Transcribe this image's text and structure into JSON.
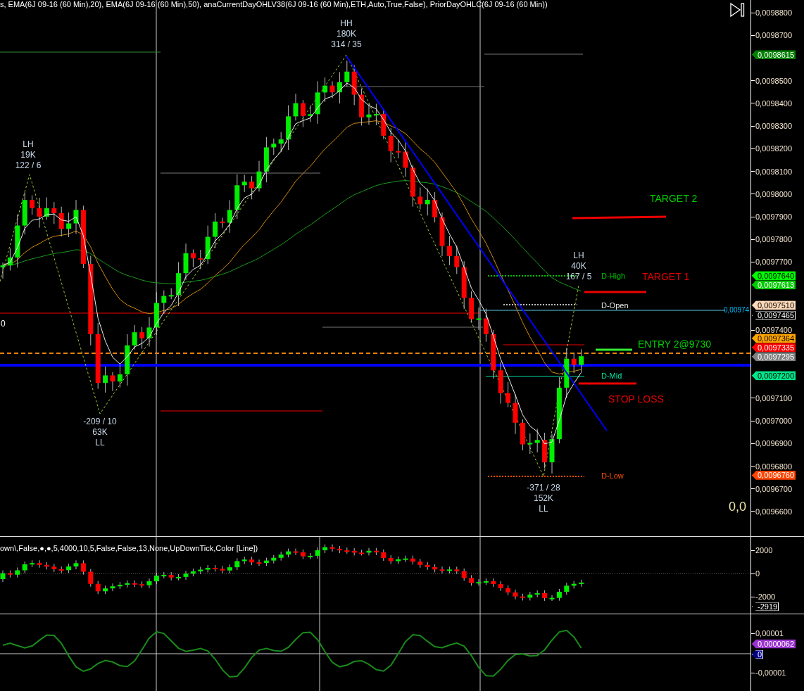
{
  "header": {
    "indicators": "s, EMA(6J 09-16 (60 Min),20), EMA(6J 09-16 (60 Min),50), anaCurrentDayOHLV38(6J 09-16 (60 Min),ETH,Auto,True,False), PriorDayOHLC(6J 09-16 (60 Min))"
  },
  "price_axis": {
    "ticks": [
      "0,0098800",
      "0,0098700",
      "0,0098500",
      "0,0098400",
      "0,0098300",
      "0,0098200",
      "0,0098100",
      "0,0098000",
      "0,0097900",
      "0,0097800",
      "0,0097700",
      "0,0097400",
      "0,0097100",
      "0,0097000",
      "0,0096900",
      "0,0096800",
      "0,0096700",
      "0,0096600"
    ],
    "tags": [
      {
        "text": "0,0098615",
        "color": "#008000"
      },
      {
        "text": "0,0097640",
        "color": "#00ff00"
      },
      {
        "text": "0,0097613",
        "color": "#00cc00"
      },
      {
        "text": "0,0097510",
        "color": "#ffdab9"
      },
      {
        "text": "0,0097465",
        "color": "#000000"
      },
      {
        "text": "0,0097364",
        "color": "#ffa500"
      },
      {
        "text": "0,0097335",
        "color": "#ff0000"
      },
      {
        "text": "0,0097295",
        "color": "#808080"
      },
      {
        "text": "0,0097200",
        "color": "#00e68a"
      },
      {
        "text": "0,0096760",
        "color": "#ff4500"
      }
    ]
  },
  "side_readouts": [
    {
      "text": "0",
      "color": "#ffffff"
    },
    {
      "text": "0,00974",
      "color": "#00bfff"
    },
    {
      "text": "0,0",
      "color": "#eee8aa"
    }
  ],
  "swing_labels": [
    {
      "lines": [
        "LH",
        "19K",
        "122 / 6"
      ]
    },
    {
      "lines": [
        "HH",
        "180K",
        "314 / 35"
      ]
    },
    {
      "lines": [
        "LH",
        "40K",
        "167 / 5"
      ]
    },
    {
      "lines": [
        "-209 / 10",
        "63K",
        "LL"
      ]
    },
    {
      "lines": [
        "-371 / 28",
        "152K",
        "LL"
      ]
    }
  ],
  "level_labels": [
    {
      "text": "D-High",
      "color": "#00c000"
    },
    {
      "text": "D-Open",
      "color": "#e6e6e6"
    },
    {
      "text": "D-Mid",
      "color": "#00e0a0"
    },
    {
      "text": "D-Low",
      "color": "#ff5000"
    }
  ],
  "trade_labels": [
    {
      "text": "TARGET 2",
      "color": "#00d000"
    },
    {
      "text": "TARGET 1",
      "color": "#e00000"
    },
    {
      "text": "ENTRY 2@9730",
      "color": "#00d000"
    },
    {
      "text": "STOP LOSS",
      "color": "#e00000"
    }
  ],
  "volume_panel": {
    "title": "own\\,False,●,●,5,4000,10,5,False,False,13,None,UpDownTick,Color [Line])",
    "ticks": [
      "2000",
      "0",
      "-2000"
    ],
    "tag": "-2919"
  },
  "oscillator_panel": {
    "ticks": [
      "0,00001",
      "-0,00001"
    ],
    "tags": [
      {
        "text": "0,0000062",
        "color": "#9932cc"
      },
      {
        "text": "0",
        "color": "#00008b"
      }
    ]
  }
}
